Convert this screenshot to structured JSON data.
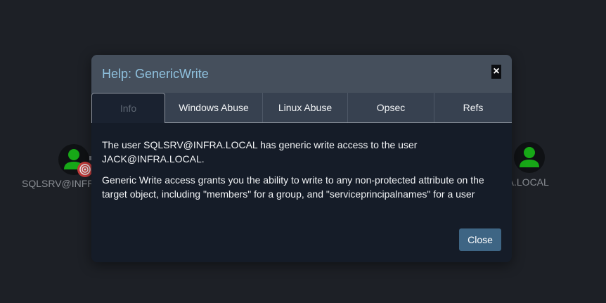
{
  "graph": {
    "left_node_label": "SQLSRV@INFRA.LOCAL",
    "right_node_label": "JACK@INFRA.LOCAL",
    "node_icon": "user-icon",
    "badge_icon": "target-icon",
    "colors": {
      "background": "#1d2026",
      "user_icon": "#17a817",
      "badge": "#c23b3b"
    }
  },
  "modal": {
    "title": "Help: GenericWrite",
    "close_x": "×",
    "tabs": [
      {
        "label": "Info",
        "active": true
      },
      {
        "label": "Windows Abuse",
        "active": false
      },
      {
        "label": "Linux Abuse",
        "active": false
      },
      {
        "label": "Opsec",
        "active": false
      },
      {
        "label": "Refs",
        "active": false
      }
    ],
    "body": {
      "paragraph_1": "The user SQLSRV@INFRA.LOCAL has generic write access to the user JACK@INFRA.LOCAL.",
      "paragraph_2": "Generic Write access grants you the ability to write to any non-protected attribute on the target object, including \"members\" for a group, and \"serviceprincipalnames\" for a user"
    },
    "close_button": "Close",
    "colors": {
      "title": "#8fc1de",
      "header": "#454f5c",
      "body_bg": "#151c28",
      "button": "#3e6584"
    }
  }
}
